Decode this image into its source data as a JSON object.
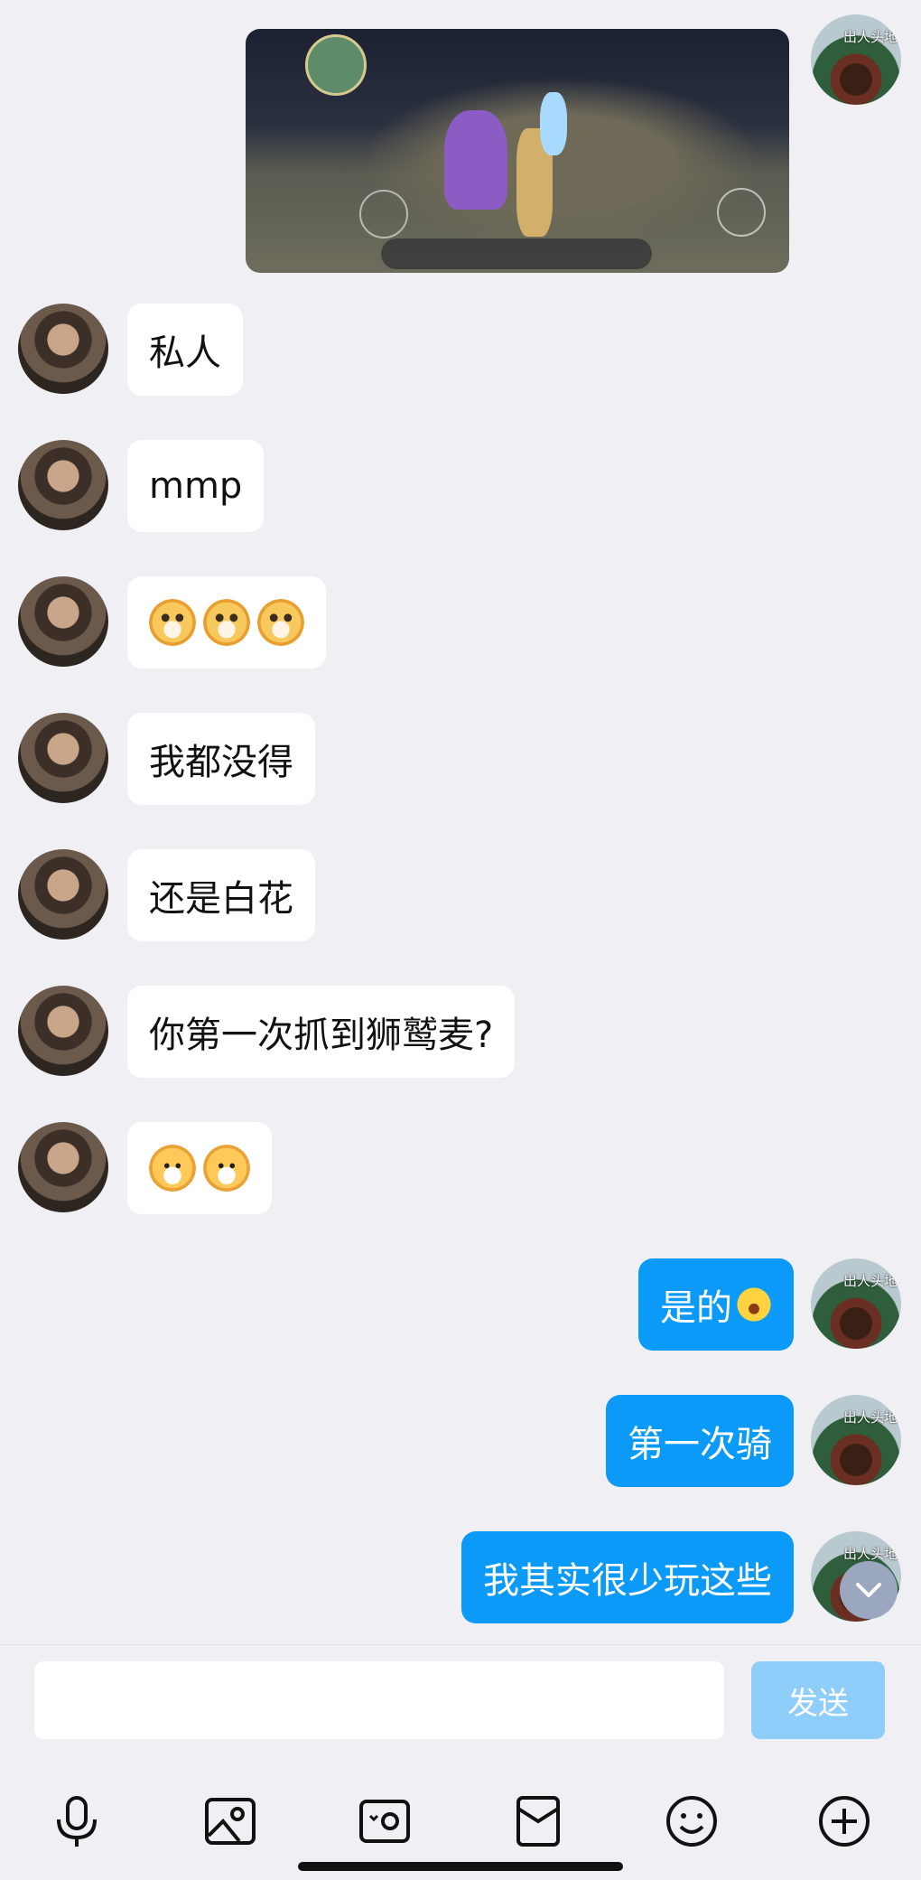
{
  "messages": [
    {
      "from": "peer",
      "text": "私人"
    },
    {
      "from": "peer",
      "text": "mmp"
    },
    {
      "from": "peer",
      "sticker": "dog-sticker",
      "count": 3
    },
    {
      "from": "peer",
      "text": "我都没得"
    },
    {
      "from": "peer",
      "text": "还是白花"
    },
    {
      "from": "peer",
      "text": "你第一次抓到狮鹫麦?"
    },
    {
      "from": "peer",
      "sticker": "cat-sticker",
      "count": 2
    },
    {
      "from": "me",
      "text": "是的",
      "emoji": "laughing-tears-emoji"
    },
    {
      "from": "me",
      "text": "第一次骑"
    },
    {
      "from": "me",
      "text": "我其实很少玩这些"
    }
  ],
  "me_avatar_caption": "出人头地",
  "composer": {
    "input_value": "",
    "send_label": "发送"
  },
  "toolbar": [
    "microphone-icon",
    "image-icon",
    "camera-icon",
    "red-packet-icon",
    "smiley-icon",
    "plus-icon"
  ],
  "colors": {
    "background": "#efeff4",
    "my_bubble": "#0b9af7",
    "peer_bubble": "#ffffff",
    "send_disabled": "#8fcdfa"
  }
}
